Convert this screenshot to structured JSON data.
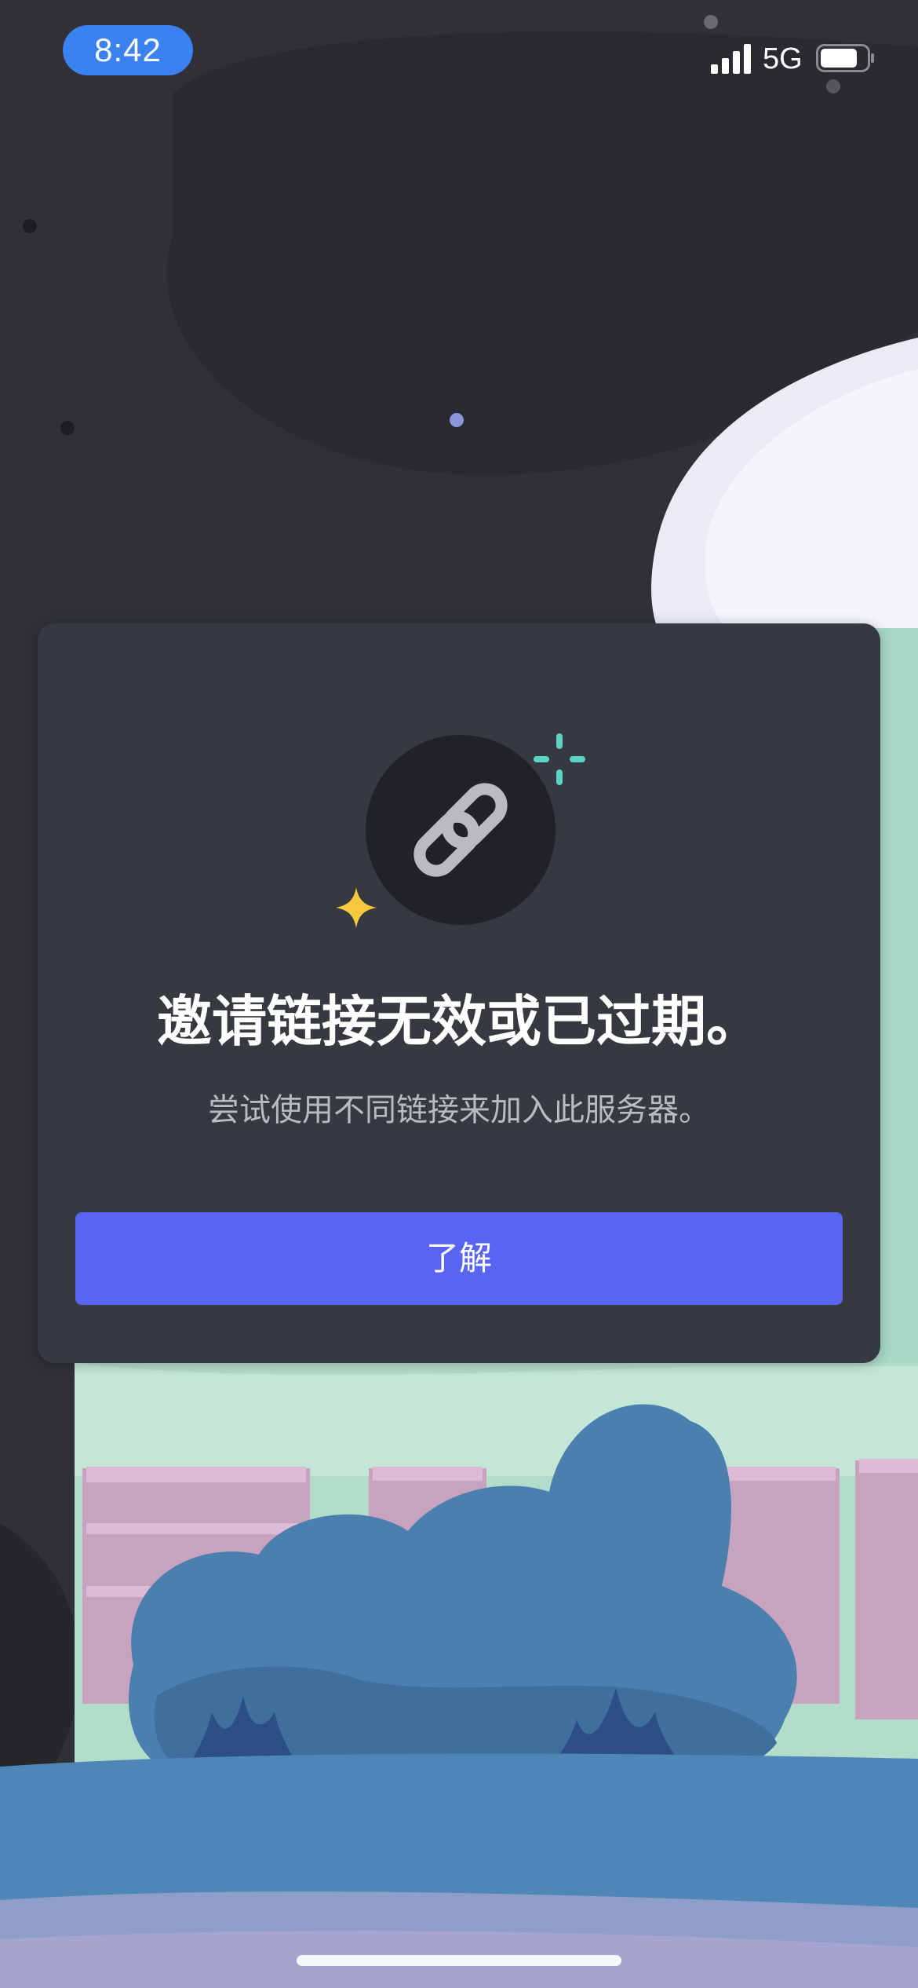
{
  "status_bar": {
    "time": "8:42",
    "network": "5G"
  },
  "dialog": {
    "icon": "link-icon",
    "title": "邀请链接无效或已过期。",
    "subtitle": "尝试使用不同链接来加入此服务器。",
    "button_label": "了解"
  },
  "colors": {
    "background": "#303136",
    "card": "#36393f",
    "button": "#5865f2",
    "time_pill": "#3b82f0",
    "subtitle_text": "#b9bbbe"
  }
}
